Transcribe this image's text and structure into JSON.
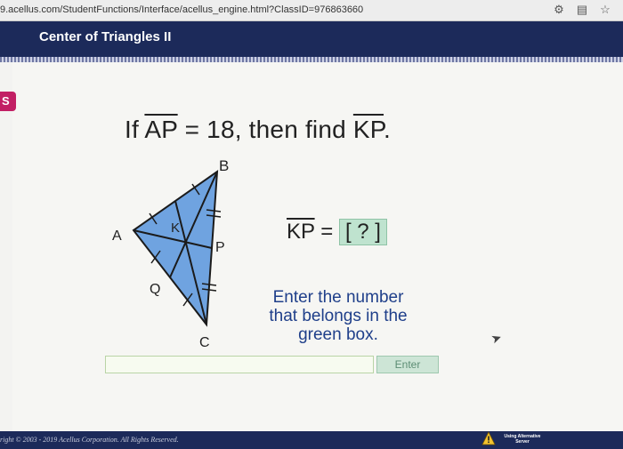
{
  "browser": {
    "url": "9.acellus.com/StudentFunctions/Interface/acellus_engine.html?ClassID=976863660",
    "icons": [
      "puzzle-icon",
      "reader-icon",
      "star-icon"
    ]
  },
  "header": {
    "title": "Center of Triangles II"
  },
  "sidebar": {
    "tab_label": "S"
  },
  "question": {
    "prefix": "If ",
    "segment1": "AP",
    "mid": " = 18, then find ",
    "segment2": "KP",
    "suffix": "."
  },
  "figure": {
    "labels": {
      "A": "A",
      "B": "B",
      "C": "C",
      "K": "K",
      "P": "P",
      "Q": "Q"
    },
    "fill_color": "#6fa3e0",
    "line_color": "#1b1b1b"
  },
  "answer": {
    "segment": "KP",
    "equals": " = ",
    "box_text": "[ ? ]"
  },
  "instructions": "Enter the number that belongs in the green box.",
  "input": {
    "value": "",
    "placeholder": ""
  },
  "enter_button": {
    "label": "Enter"
  },
  "footer": {
    "copyright": "right © 2003 - 2019 Acellus Corporation.  All Rights Reserved.",
    "server_text": "Using Alternative Server"
  },
  "colors": {
    "header_bg": "#1c2a5a",
    "tab_accent": "#c21f64",
    "answer_box": "#bfe3cf",
    "instructions_text": "#1f3f8a"
  }
}
